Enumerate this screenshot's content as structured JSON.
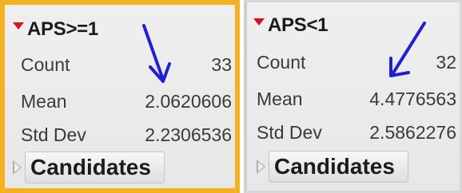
{
  "panels": [
    {
      "title": "APS>=1",
      "stats": [
        {
          "label": "Count",
          "value": "33"
        },
        {
          "label": "Mean",
          "value": "2.0620606"
        },
        {
          "label": "Std Dev",
          "value": "2.2306536"
        }
      ],
      "candidates_label": "Candidates",
      "highlighted": true
    },
    {
      "title": "APS<1",
      "stats": [
        {
          "label": "Count",
          "value": "32"
        },
        {
          "label": "Mean",
          "value": "4.4776563"
        },
        {
          "label": "Std Dev",
          "value": "2.5862276"
        }
      ],
      "candidates_label": "Candidates",
      "highlighted": false
    }
  ],
  "colors": {
    "highlight_border": "#f4b120",
    "disclosure_red": "#d8121a",
    "annotation_arrow": "#1f1fd6"
  },
  "icons": {
    "disclosure": "red-triangle-icon",
    "expand": "expand-triangle-icon",
    "annotation": "blue-arrow-icon"
  }
}
